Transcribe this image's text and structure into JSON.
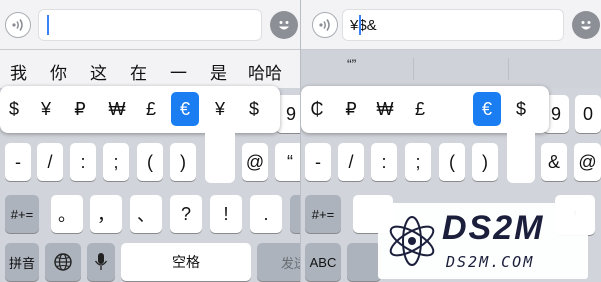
{
  "left": {
    "candidates": [
      "我",
      "你",
      "这",
      "在",
      "一",
      "是",
      "哈哈"
    ],
    "popup_symbols": [
      "$",
      "¥",
      "₽",
      "₩",
      "£",
      "€",
      "¥",
      "$"
    ],
    "selected_symbol": "€",
    "row2_keys": [
      "-",
      "/",
      ":",
      ";",
      "(",
      ")",
      "@",
      "“"
    ],
    "row3_func": "#+=",
    "row3_keys": [
      "。",
      "，",
      "、",
      "?",
      "!",
      "."
    ],
    "row4": {
      "mode_label": "拼音",
      "space_label": "空格",
      "send_label": "发送"
    },
    "partial_key": "9"
  },
  "right": {
    "field_value": "¥$&",
    "candidate_quote": "“”",
    "popup_symbols": [
      "₵",
      "₽",
      "₩",
      "£",
      "€",
      "$"
    ],
    "selected_symbol": "€",
    "partial_keys": [
      "9",
      "0"
    ],
    "row2_keys": [
      "-",
      "/",
      ":",
      ";",
      "(",
      ")",
      "&",
      "@"
    ],
    "row3_func": "#+=",
    "row3_key_partial": ",",
    "row4": {
      "mode_label": "ABC"
    }
  },
  "watermark": {
    "brand": "DS2M",
    "url": "DS2M.COM"
  }
}
